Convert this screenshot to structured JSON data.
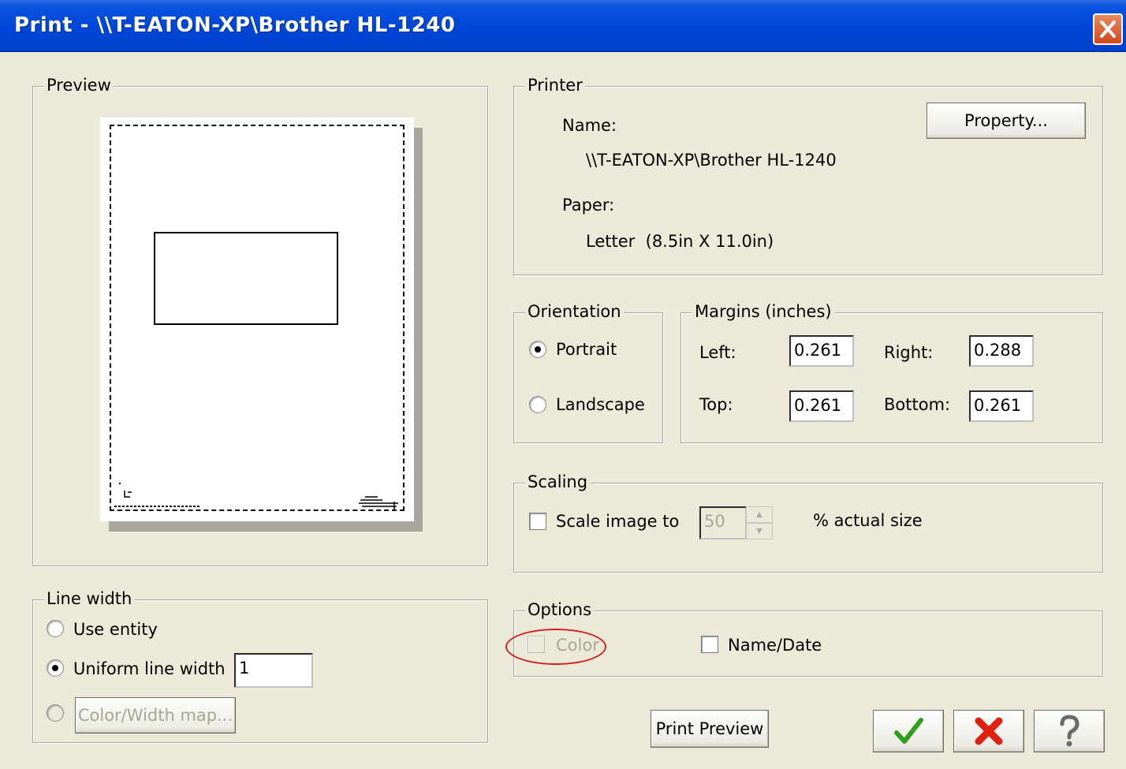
{
  "window": {
    "title": "Print - \\\\T-EATON-XP\\Brother HL-1240"
  },
  "preview": {
    "legend": "Preview"
  },
  "printer": {
    "legend": "Printer",
    "name_label": "Name:",
    "name_value": "\\\\T-EATON-XP\\Brother HL-1240",
    "paper_label": "Paper:",
    "paper_value": "Letter  (8.5in X 11.0in)",
    "property_button": "Property..."
  },
  "orientation": {
    "legend": "Orientation",
    "portrait": "Portrait",
    "landscape": "Landscape",
    "selected": "portrait"
  },
  "margins": {
    "legend": "Margins (inches)",
    "left_label": "Left:",
    "left_value": "0.261",
    "right_label": "Right:",
    "right_value": "0.288",
    "top_label": "Top:",
    "top_value": "0.261",
    "bottom_label": "Bottom:",
    "bottom_value": "0.261"
  },
  "scaling": {
    "legend": "Scaling",
    "checkbox_label": "Scale image to",
    "value": "50",
    "suffix": "% actual size"
  },
  "options": {
    "legend": "Options",
    "color_label": "Color",
    "namedate_label": "Name/Date"
  },
  "line_width": {
    "legend": "Line width",
    "use_entity": "Use entity",
    "uniform": "Uniform line width",
    "uniform_value": "1",
    "color_width_map": "Color/Width map...",
    "selected": "uniform"
  },
  "buttons": {
    "print_preview": "Print Preview"
  },
  "colors": {
    "title_bar": "#0046d8",
    "dialog_bg": "#ece9d8",
    "ok_green": "#2e9e1e",
    "cancel_red": "#e02010",
    "highlight_ellipse": "#d02020"
  }
}
